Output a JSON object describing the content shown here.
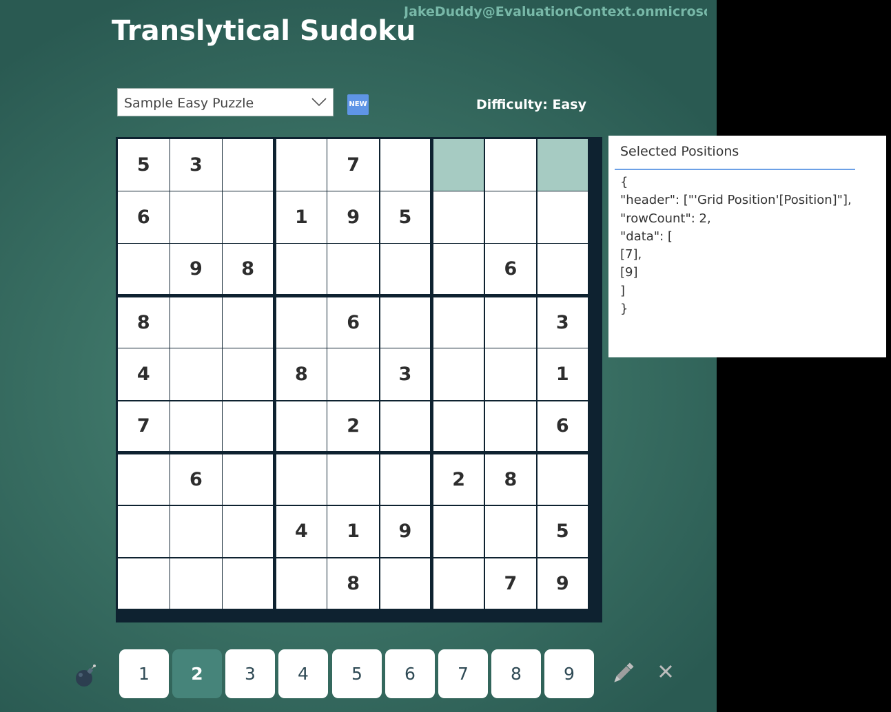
{
  "header": {
    "user_email": "JakeDuddy@EvaluationContext.onmicrosof...",
    "title": "Translytical Sudoku"
  },
  "toolbar": {
    "puzzle_select_value": "Sample Easy Puzzle",
    "new_button_label": "NEW",
    "difficulty_label": "Difficulty: Easy"
  },
  "board": {
    "rows": [
      [
        "5",
        "3",
        "",
        "",
        "7",
        "",
        "",
        "",
        ""
      ],
      [
        "6",
        "",
        "",
        "1",
        "9",
        "5",
        "",
        "",
        ""
      ],
      [
        "",
        "9",
        "8",
        "",
        "",
        "",
        "",
        "6",
        ""
      ],
      [
        "8",
        "",
        "",
        "",
        "6",
        "",
        "",
        "",
        "3"
      ],
      [
        "4",
        "",
        "",
        "8",
        "",
        "3",
        "",
        "",
        "1"
      ],
      [
        "7",
        "",
        "",
        "",
        "2",
        "",
        "",
        "",
        "6"
      ],
      [
        "",
        "6",
        "",
        "",
        "",
        "",
        "2",
        "8",
        ""
      ],
      [
        "",
        "",
        "",
        "4",
        "1",
        "9",
        "",
        "",
        "5"
      ],
      [
        "",
        "",
        "",
        "",
        "8",
        "",
        "",
        "7",
        "9"
      ]
    ],
    "selected_positions": [
      7,
      9
    ]
  },
  "selected_panel": {
    "title": "Selected Positions",
    "json_lines": [
      "{",
      "\"header\": [\"'Grid Position'[Position]\"],",
      "\"rowCount\": 2,",
      "\"data\": [",
      "[7],",
      "[9]",
      "]",
      "}"
    ]
  },
  "numpad": {
    "buttons": [
      "1",
      "2",
      "3",
      "4",
      "5",
      "6",
      "7",
      "8",
      "9"
    ],
    "active": "2"
  },
  "icons": {
    "bomb": "bomb-icon",
    "pencil": "pencil-icon",
    "clear": "close-icon"
  },
  "colors": {
    "accent": "#46847a",
    "selected_cell": "#a6cbc2",
    "new_button": "#5f95e6",
    "grid_line": "#0e2230"
  }
}
